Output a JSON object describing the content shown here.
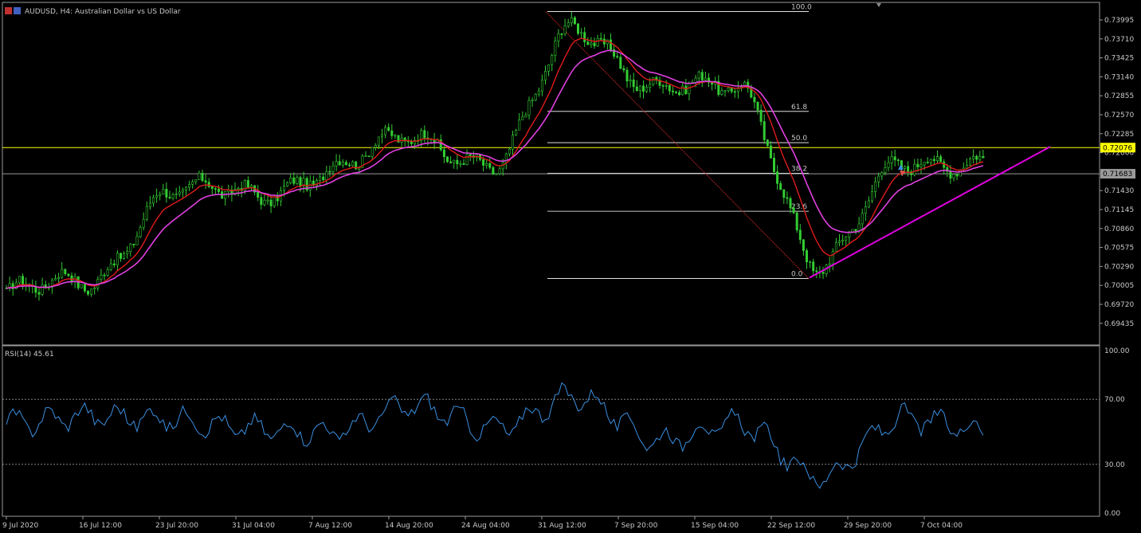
{
  "symbol_title": "AUDUSD, H4:  Australian Dollar vs US Dollar",
  "colors": {
    "background": "#000000",
    "candles": "#33cc33",
    "ma_fast": "#e01b1b",
    "ma_slow": "#e040e0",
    "trendline": "#e000e0",
    "yellow_level": "#ffff00",
    "rsi": "#3a8fe0",
    "fib_lines": "#ffffff"
  },
  "price_axis": {
    "ticks": [
      "0.73995",
      "0.73710",
      "0.73425",
      "0.73140",
      "0.72855",
      "0.72570",
      "0.72285",
      "0.72000",
      "0.71430",
      "0.71145",
      "0.70860",
      "0.70575",
      "0.70290",
      "0.70005",
      "0.69720",
      "0.69435"
    ],
    "marker_yellow": "0.72076",
    "marker_current": "0.71683"
  },
  "fibonacci": {
    "levels": [
      {
        "label": "100.0",
        "price": 0.7412
      },
      {
        "label": "61.8",
        "price": 0.7262
      },
      {
        "label": "50.0",
        "price": 0.7215
      },
      {
        "label": "38.2",
        "price": 0.7169
      },
      {
        "label": "23.6",
        "price": 0.7112
      },
      {
        "label": "0.0",
        "price": 0.7011
      }
    ]
  },
  "rsi": {
    "label": "RSI(14) 45.61",
    "levels": [
      "100.00",
      "70.00",
      "30.00",
      "0.00"
    ]
  },
  "time_axis": [
    "9 Jul 2020",
    "16 Jul 12:00",
    "23 Jul 20:00",
    "31 Jul 04:00",
    "7 Aug 12:00",
    "14 Aug 20:00",
    "24 Aug 04:00",
    "31 Aug 12:00",
    "7 Sep 20:00",
    "15 Sep 04:00",
    "22 Sep 12:00",
    "29 Sep 20:00",
    "7 Oct 04:00"
  ],
  "chart_data": {
    "type": "line",
    "x": [
      "9 Jul 2020",
      "16 Jul 12:00",
      "23 Jul 20:00",
      "31 Jul 04:00",
      "7 Aug 12:00",
      "14 Aug 20:00",
      "24 Aug 04:00",
      "31 Aug 12:00",
      "7 Sep 20:00",
      "15 Sep 04:00",
      "22 Sep 12:00",
      "29 Sep 20:00",
      "7 Oct 04:00"
    ],
    "series": [],
    "price_path": [
      {
        "time": "9 Jul 2020",
        "price": 0.699
      },
      {
        "time": "16 Jul 12:00",
        "price": 0.7005
      },
      {
        "time": "23 Jul 20:00",
        "price": 0.714
      },
      {
        "time": "31 Jul 04:00",
        "price": 0.714
      },
      {
        "time": "7 Aug 12:00",
        "price": 0.717
      },
      {
        "time": "14 Aug 20:00",
        "price": 0.723
      },
      {
        "time": "24 Aug 04:00",
        "price": 0.7175
      },
      {
        "time": "31 Aug 12:00",
        "price": 0.7395
      },
      {
        "time": "7 Sep 20:00",
        "price": 0.729
      },
      {
        "time": "15 Sep 04:00",
        "price": 0.7305
      },
      {
        "time": "22 Sep 12:00",
        "price": 0.702
      },
      {
        "time": "29 Sep 20:00",
        "price": 0.7195
      },
      {
        "time": "7 Oct 04:00",
        "price": 0.7175
      }
    ],
    "rsi_path": [
      {
        "time": "9 Jul 2020",
        "value": 55
      },
      {
        "time": "16 Jul 12:00",
        "value": 60
      },
      {
        "time": "23 Jul 20:00",
        "value": 58
      },
      {
        "time": "31 Jul 04:00",
        "value": 52
      },
      {
        "time": "7 Aug 12:00",
        "value": 50
      },
      {
        "time": "14 Aug 20:00",
        "value": 66
      },
      {
        "time": "24 Aug 04:00",
        "value": 52
      },
      {
        "time": "31 Aug 12:00",
        "value": 72
      },
      {
        "time": "7 Sep 20:00",
        "value": 45
      },
      {
        "time": "15 Sep 04:00",
        "value": 55
      },
      {
        "time": "22 Sep 12:00",
        "value": 22
      },
      {
        "time": "29 Sep 20:00",
        "value": 58
      },
      {
        "time": "7 Oct 04:00",
        "value": 52
      }
    ],
    "ylim": [
      0.693,
      0.743
    ],
    "rsi_ylim": [
      0,
      100
    ]
  }
}
